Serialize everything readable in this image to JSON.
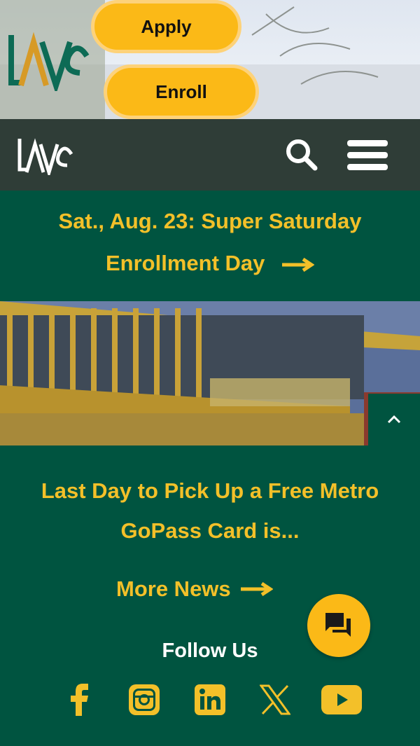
{
  "top": {
    "apply_label": "Apply",
    "enroll_label": "Enroll",
    "logo_text": "LAVC"
  },
  "header": {
    "logo_text": "LAVC"
  },
  "announcement": {
    "line1": "Sat., Aug. 23: Super Saturday",
    "line2": "Enrollment Day"
  },
  "news": {
    "title_line1": "Last Day to Pick Up a Free Metro",
    "title_line2": "GoPass Card is...",
    "more_label": "More News"
  },
  "social": {
    "heading": "Follow Us",
    "icons": [
      "facebook-icon",
      "instagram-icon",
      "linkedin-icon",
      "x-icon",
      "youtube-icon"
    ]
  },
  "colors": {
    "green": "#005440",
    "gold": "#fbb917",
    "dark": "#2f3d37",
    "text_gold": "#f3c029"
  }
}
